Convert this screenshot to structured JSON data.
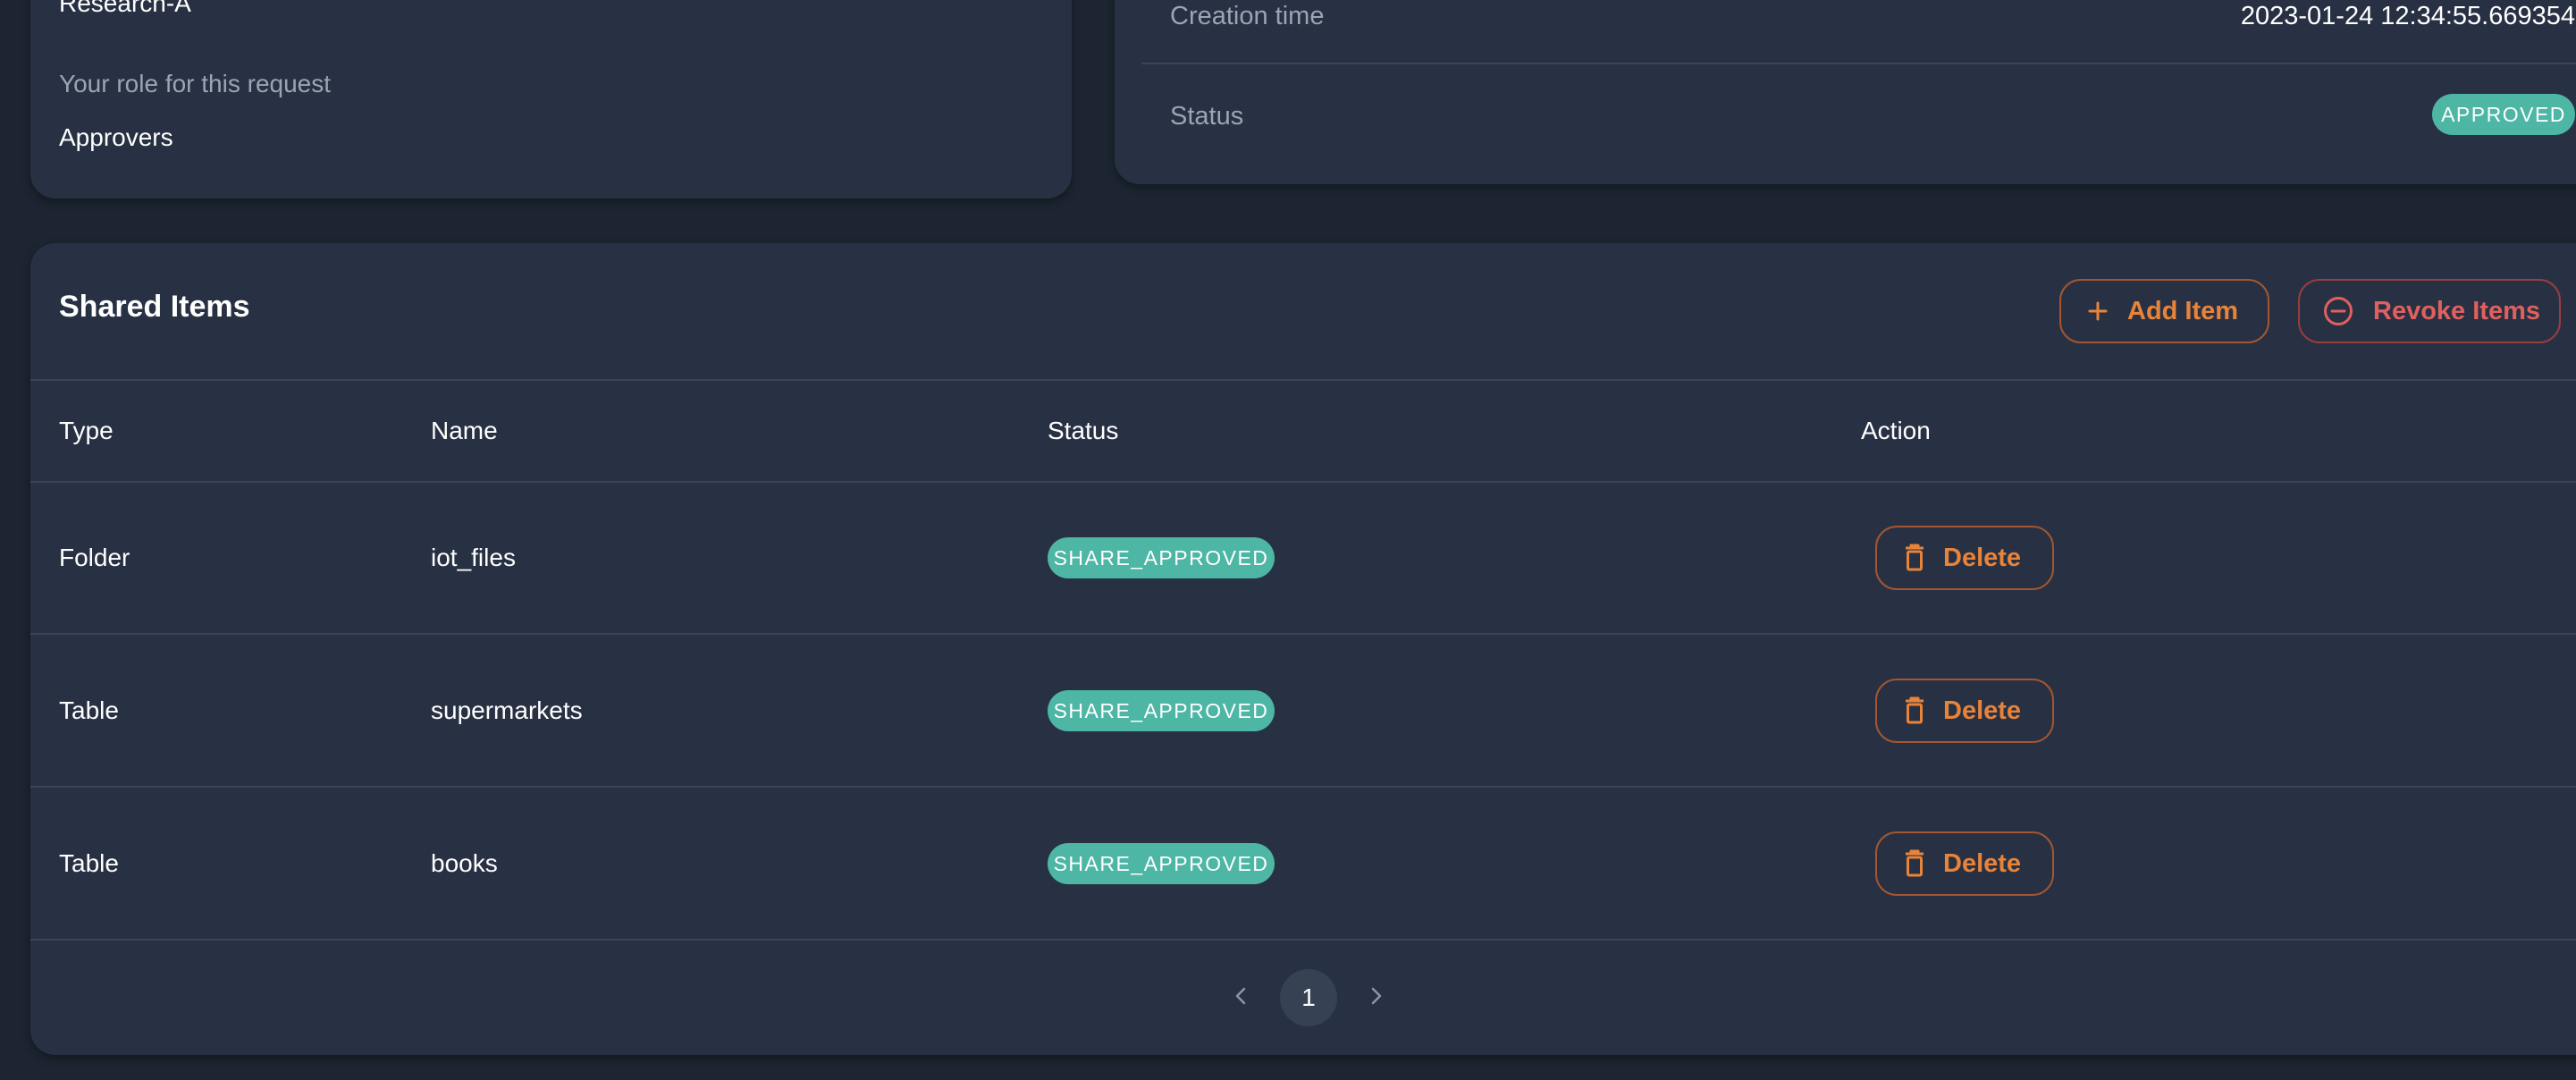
{
  "request_card": {
    "team_value": "Research-A",
    "role_label": "Your role for this request",
    "role_value": "Approvers"
  },
  "details_card": {
    "creation_time_label": "Creation time",
    "creation_time_value": "2023-01-24 12:34:55.669354",
    "status_label": "Status",
    "status_value": "APPROVED"
  },
  "shared_items": {
    "title": "Shared Items",
    "add_item_label": "Add Item",
    "revoke_items_label": "Revoke Items",
    "columns": [
      "Type",
      "Name",
      "Status",
      "Action"
    ],
    "rows": [
      {
        "type": "Folder",
        "name": "iot_files",
        "status": "SHARE_APPROVED",
        "action": "Delete"
      },
      {
        "type": "Table",
        "name": "supermarkets",
        "status": "SHARE_APPROVED",
        "action": "Delete"
      },
      {
        "type": "Table",
        "name": "books",
        "status": "SHARE_APPROVED",
        "action": "Delete"
      }
    ],
    "pagination": {
      "current_page": "1"
    }
  },
  "colors": {
    "background": "#1c2531",
    "card": "#283143",
    "badge_teal": "#4db6a5",
    "accent_orange": "#e8833a",
    "danger_red": "#e0605e"
  },
  "icons": {
    "add": "plus-icon",
    "revoke": "minus-circle-icon",
    "delete": "trash-icon",
    "prev": "chevron-left-icon",
    "next": "chevron-right-icon"
  }
}
